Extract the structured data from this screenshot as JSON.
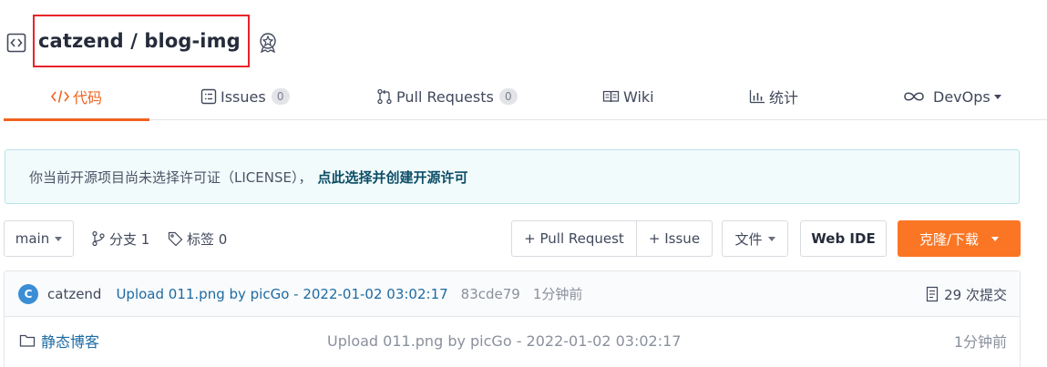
{
  "repo": {
    "title": "catzend / blog-img"
  },
  "tabs": [
    {
      "label": "代码",
      "active": true
    },
    {
      "label": "Issues",
      "count": "0"
    },
    {
      "label": "Pull Requests",
      "count": "0"
    },
    {
      "label": "Wiki"
    },
    {
      "label": "统计"
    },
    {
      "label": "DevOps"
    }
  ],
  "notice": {
    "text": "你当前开源项目尚未选择许可证（LICENSE），",
    "link": "点此选择并创建开源许可"
  },
  "toolbar": {
    "branch": "main",
    "branches_label": "分支 1",
    "tags_label": "标签 0",
    "pull_request_label": "+ Pull Request",
    "issue_label": "+ Issue",
    "file_label": "文件",
    "webide_label": "Web IDE",
    "clone_label": "克隆/下载"
  },
  "commit": {
    "avatar_letter": "C",
    "user": "catzend",
    "message": "Upload 011.png by picGo - 2022-01-02 03:02:17",
    "hash": "83cde79",
    "time": "1分钟前",
    "count_label": "29 次提交"
  },
  "files": [
    {
      "name": "静态博客",
      "message": "Upload 011.png by picGo - 2022-01-02 03:02:17",
      "time": "1分钟前"
    }
  ],
  "colors": {
    "accent": "#f0631f",
    "clone_button": "#fa7624",
    "link": "#1d6aa2",
    "highlight_box": "#e8232a"
  }
}
